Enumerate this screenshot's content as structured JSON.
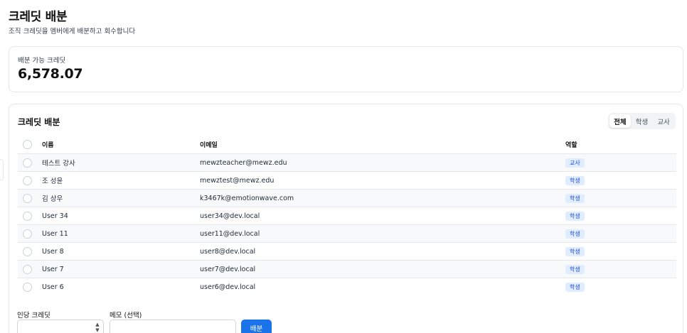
{
  "header": {
    "title": "크레딧 배분",
    "subtitle": "조직 크레딧을 멤버에게 배분하고 회수합니다"
  },
  "summary": {
    "label": "배분 가능 크레딧",
    "value": "6,578.07"
  },
  "distribution": {
    "title": "크레딧 배분",
    "filters": [
      {
        "label": "전체",
        "active": true
      },
      {
        "label": "학생",
        "active": false
      },
      {
        "label": "교사",
        "active": false
      }
    ],
    "columns": {
      "name": "이름",
      "email": "이메일",
      "role": "역할"
    },
    "rows": [
      {
        "name": "테스트 강사",
        "email": "mewzteacher@mewz.edu",
        "role": "교사"
      },
      {
        "name": "조 성윤",
        "email": "mewztest@mewz.edu",
        "role": "학생"
      },
      {
        "name": "김 상우",
        "email": "k3467k@emotionwave.com",
        "role": "학생"
      },
      {
        "name": "User 34",
        "email": "user34@dev.local",
        "role": "학생"
      },
      {
        "name": "User 11",
        "email": "user11@dev.local",
        "role": "학생"
      },
      {
        "name": "User 8",
        "email": "user8@dev.local",
        "role": "학생"
      },
      {
        "name": "User 7",
        "email": "user7@dev.local",
        "role": "학생"
      },
      {
        "name": "User 6",
        "email": "user6@dev.local",
        "role": "학생"
      }
    ]
  },
  "form": {
    "credits_label": "인당 크레딧",
    "memo_label": "메모 (선택)",
    "submit_label": "배분"
  },
  "colors": {
    "accent": "#1a73e8",
    "badge_bg": "#e0ecff",
    "badge_text": "#1d4ed8"
  }
}
